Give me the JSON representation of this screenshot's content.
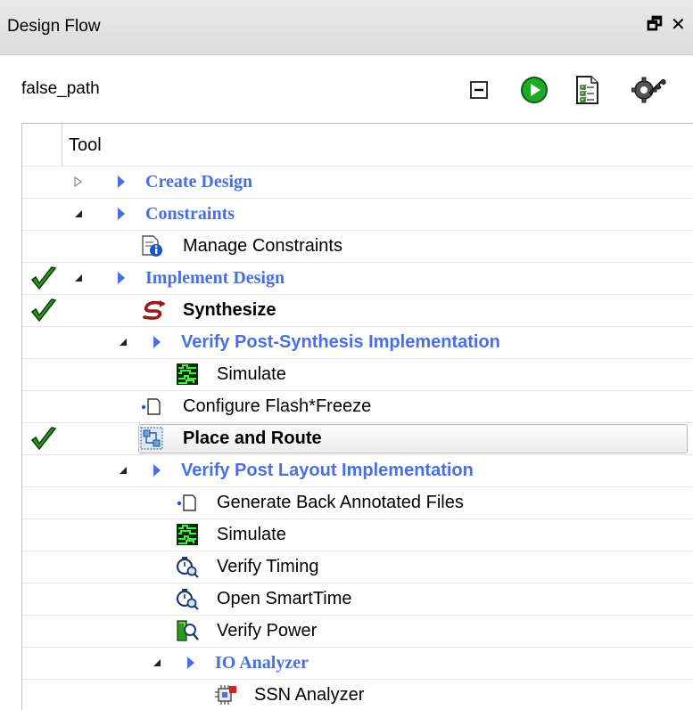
{
  "panel": {
    "title": "Design Flow",
    "restore_glyph": "🗗",
    "close_glyph": "✕"
  },
  "design_name": "false_path",
  "toolbar": {
    "icons": [
      "collapse-all-icon",
      "run-icon",
      "report-icon",
      "settings-wrench-icon"
    ]
  },
  "tree": {
    "header": "Tool",
    "rows": [
      {
        "label": "Create Design",
        "type": "category",
        "expander": "collapsed",
        "check": false
      },
      {
        "label": "Constraints",
        "type": "category",
        "expander": "expanded",
        "check": false
      },
      {
        "label": "Manage Constraints",
        "type": "tool",
        "icon": "document-info-icon",
        "check": false
      },
      {
        "label": "Implement Design",
        "type": "category",
        "expander": "expanded",
        "check": true
      },
      {
        "label": "Synthesize",
        "type": "tool-bold",
        "icon": "synthesize-icon",
        "check": true
      },
      {
        "label": "Verify Post-Synthesis Implementation",
        "type": "category",
        "expander": "expanded",
        "check": false
      },
      {
        "label": "Simulate",
        "type": "tool",
        "icon": "waveform-icon",
        "check": false
      },
      {
        "label": "Configure Flash*Freeze",
        "type": "tool",
        "icon": "optional-box-icon",
        "check": false
      },
      {
        "label": "Place and Route",
        "type": "tool-bold",
        "icon": "place-route-icon",
        "check": true,
        "selected": true
      },
      {
        "label": "Verify Post Layout Implementation",
        "type": "category",
        "expander": "expanded",
        "check": false
      },
      {
        "label": "Generate Back Annotated Files",
        "type": "tool",
        "icon": "optional-box-icon",
        "check": false
      },
      {
        "label": "Simulate",
        "type": "tool",
        "icon": "waveform-icon",
        "check": false
      },
      {
        "label": "Verify Timing",
        "type": "tool",
        "icon": "timing-clock-icon",
        "check": false
      },
      {
        "label": "Open SmartTime",
        "type": "tool",
        "icon": "timing-clock-icon",
        "check": false
      },
      {
        "label": "Verify Power",
        "type": "tool",
        "icon": "power-magnifier-icon",
        "check": false
      },
      {
        "label": "IO Analyzer",
        "type": "category",
        "expander": "expanded",
        "check": false
      },
      {
        "label": "SSN Analyzer",
        "type": "tool",
        "icon": "ssn-analyzer-icon",
        "check": false
      }
    ]
  },
  "colors": {
    "category_blue": "#4a6fe3",
    "check_green": "#2e9a1a",
    "run_green": "#1faa2a"
  }
}
